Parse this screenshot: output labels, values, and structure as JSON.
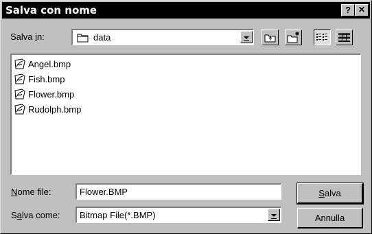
{
  "window": {
    "title": "Salva con nome",
    "help_glyph": "?",
    "close_glyph": "✕"
  },
  "look_in": {
    "label_pre": "Salva ",
    "label_u": "i",
    "label_post": "n:",
    "value": "data",
    "icon": "folder-icon"
  },
  "toolbar": {
    "up_icon": "up-folder-icon",
    "new_folder_icon": "new-folder-icon",
    "list_icon": "list-view-icon",
    "details_icon": "details-view-icon"
  },
  "files": [
    {
      "name": "Angel.bmp",
      "icon": "bitmap-file-icon"
    },
    {
      "name": "Fish.bmp",
      "icon": "bitmap-file-icon"
    },
    {
      "name": "Flower.bmp",
      "icon": "bitmap-file-icon"
    },
    {
      "name": "Rudolph.bmp",
      "icon": "bitmap-file-icon"
    }
  ],
  "filename": {
    "label_u": "N",
    "label_post": "ome file:",
    "value": "Flower.BMP"
  },
  "filetype": {
    "label_pre": "S",
    "label_u": "a",
    "label_post": "lva come:",
    "value": "Bitmap File(*.BMP)"
  },
  "buttons": {
    "save_u": "S",
    "save_post": "alva",
    "cancel": "Annulla"
  }
}
